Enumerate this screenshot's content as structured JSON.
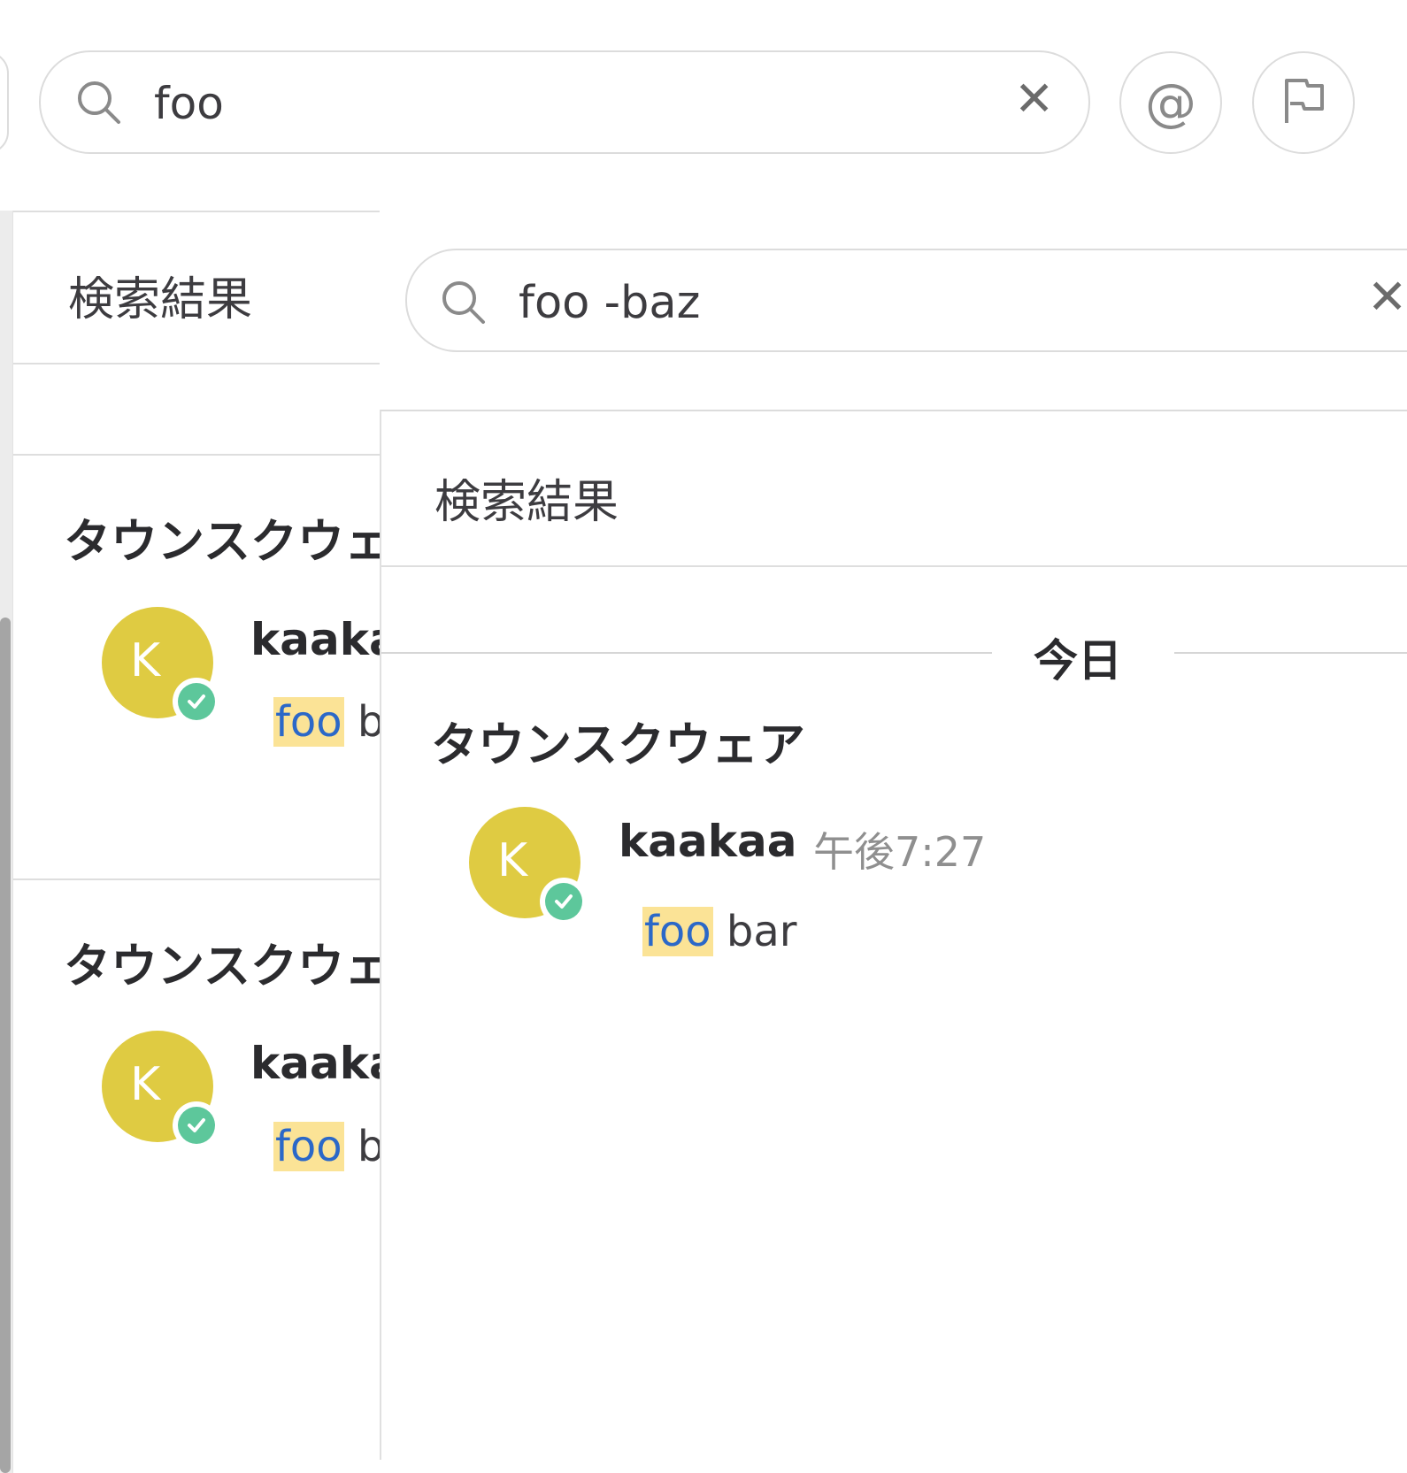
{
  "top_search": {
    "value": "foo"
  },
  "front_search": {
    "value": "foo -baz"
  },
  "header_buttons": {
    "at_label": "@"
  },
  "background_panel": {
    "title": "検索結果",
    "results": [
      {
        "channel": "タウンスクウェア",
        "username": "kaakaa",
        "avatar_letter": "K",
        "highlight": "foo",
        "rest": " bar"
      },
      {
        "channel": "タウンスクウェア",
        "username": "kaakaa",
        "avatar_letter": "K",
        "highlight": "foo",
        "rest": " bar"
      }
    ]
  },
  "front_panel": {
    "title": "検索結果",
    "date_separator": "今日",
    "result": {
      "channel": "タウンスクウェア",
      "username": "kaakaa",
      "time": "午後7:27",
      "avatar_letter": "K",
      "highlight": "foo",
      "rest": " bar"
    }
  },
  "colors": {
    "avatar": "#dfcb42",
    "status_online": "#5dc79b",
    "highlight_bg": "#fbe396",
    "highlight_text": "#2b68c8"
  },
  "icons": [
    "search-icon",
    "close-icon",
    "at-mention-icon",
    "flag-icon",
    "check-icon"
  ]
}
